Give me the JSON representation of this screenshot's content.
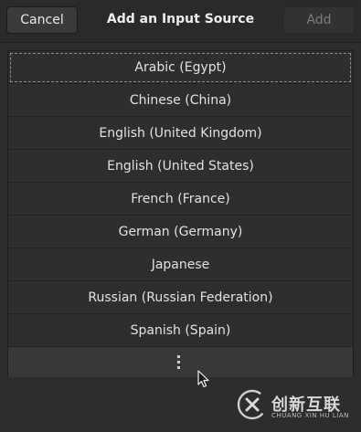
{
  "header": {
    "title": "Add an Input Source",
    "cancel_label": "Cancel",
    "add_label": "Add"
  },
  "list": {
    "items": [
      "Arabic (Egypt)",
      "Chinese (China)",
      "English (United Kingdom)",
      "English (United States)",
      "French (France)",
      "German (Germany)",
      "Japanese",
      "Russian (Russian Federation)",
      "Spanish (Spain)"
    ],
    "more_icon": "vertical-ellipsis-icon"
  },
  "watermark": {
    "cn": "创新互联",
    "en": "CHUANG XIN HU LIAN"
  },
  "colors": {
    "background": "#2d2d2d",
    "row_hover": "#383838",
    "add_disabled_text": "#7c7c7c"
  }
}
